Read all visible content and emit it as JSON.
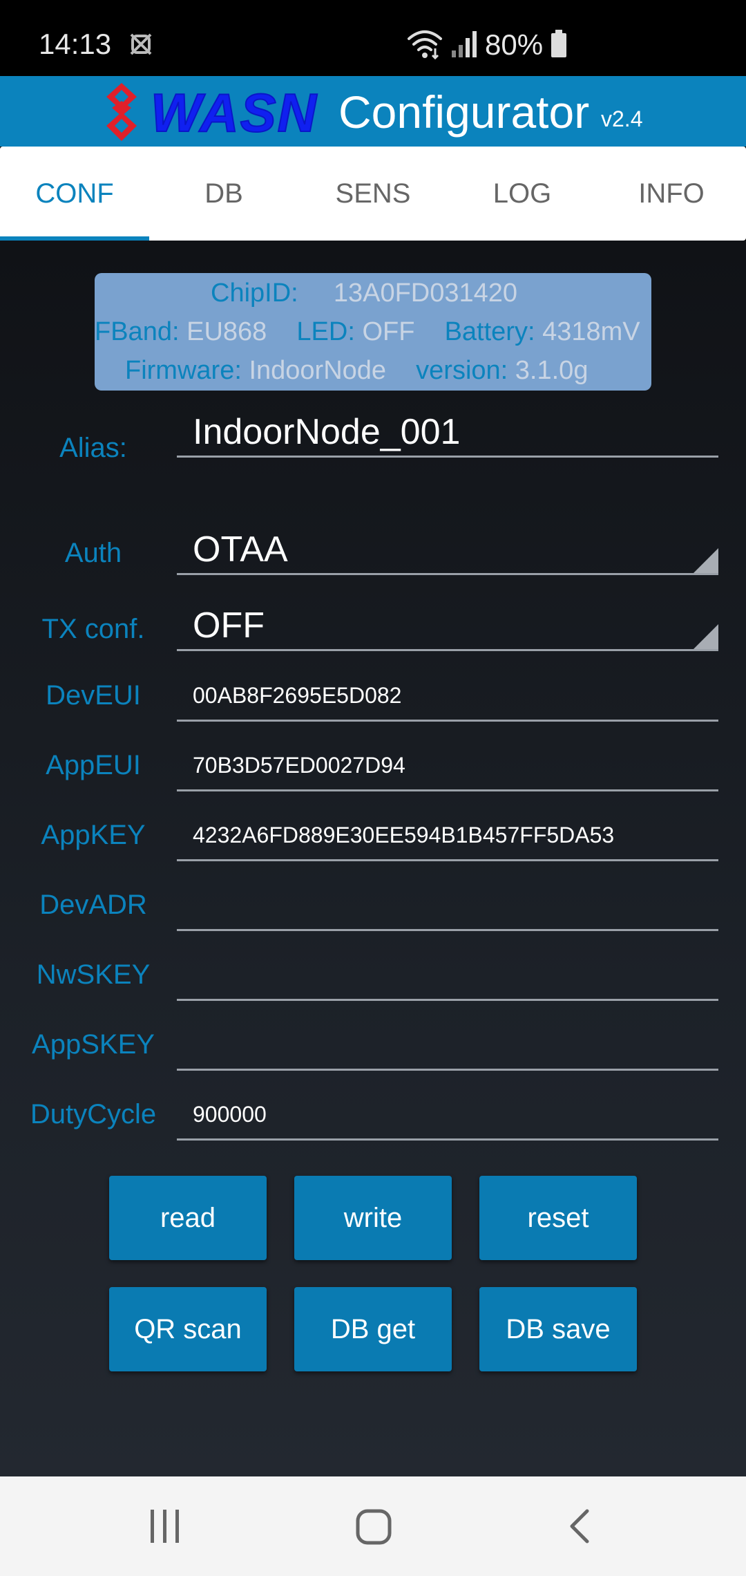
{
  "status_bar": {
    "time": "14:13",
    "battery_percent": "80%",
    "icons": [
      "notification-icon",
      "wifi-icon",
      "signal-icon",
      "battery-icon"
    ]
  },
  "header": {
    "logo_text": "WASN",
    "title": "Configurator",
    "version": "v2.4"
  },
  "tabs": [
    {
      "label": "CONF",
      "active": true
    },
    {
      "label": "DB",
      "active": false
    },
    {
      "label": "SENS",
      "active": false
    },
    {
      "label": "LOG",
      "active": false
    },
    {
      "label": "INFO",
      "active": false
    }
  ],
  "device_info": {
    "chip_id_label": "ChipID:",
    "chip_id": "13A0FD031420",
    "fband_label": "FBand:",
    "fband": "EU868",
    "led_label": "LED:",
    "led": "OFF",
    "battery_label": "Battery:",
    "battery": "4318mV",
    "firmware_label": "Firmware:",
    "firmware": "IndoorNode",
    "version_label": "version:",
    "version": "3.1.0g"
  },
  "form": {
    "alias": {
      "label": "Alias:",
      "value": "IndoorNode_001"
    },
    "auth": {
      "label": "Auth",
      "value": "OTAA"
    },
    "tx_conf": {
      "label": "TX conf.",
      "value": "OFF"
    },
    "dev_eui": {
      "label": "DevEUI",
      "value": "00AB8F2695E5D082"
    },
    "app_eui": {
      "label": "AppEUI",
      "value": "70B3D57ED0027D94"
    },
    "app_key": {
      "label": "AppKEY",
      "value": "4232A6FD889E30EE594B1B457FF5DA53"
    },
    "dev_adr": {
      "label": "DevADR",
      "value": ""
    },
    "nw_skey": {
      "label": "NwSKEY",
      "value": ""
    },
    "app_skey": {
      "label": "AppSKEY",
      "value": ""
    },
    "duty_cycle": {
      "label": "DutyCycle",
      "value": "900000"
    }
  },
  "buttons": {
    "read": "read",
    "write": "write",
    "reset": "reset",
    "qr_scan": "QR scan",
    "db_get": "DB get",
    "db_save": "DB save"
  },
  "colors": {
    "accent": "#0b83bd",
    "info_box": "#7aa2cf",
    "button": "#0a7bb2",
    "background": "#1c2128"
  }
}
